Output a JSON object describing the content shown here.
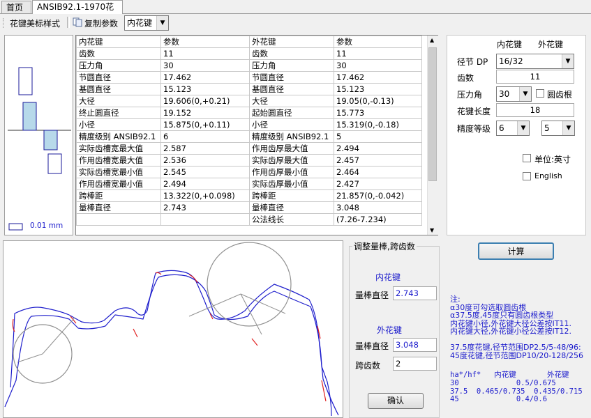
{
  "tabs": [
    "首页",
    "ANSIB92.1-1970花键"
  ],
  "toolbar": {
    "style_label": "花键美标样式",
    "copy_label": "复制参数",
    "select_value": "内花键"
  },
  "tolerance": {
    "scale_label": "0.01 mm"
  },
  "table": {
    "headers": [
      "内花键",
      "参数",
      "外花键",
      "参数"
    ],
    "rows": [
      [
        "齿数",
        "11",
        "齿数",
        "11"
      ],
      [
        "压力角",
        "30",
        "压力角",
        "30"
      ],
      [
        "节圆直径",
        "17.462",
        "节圆直径",
        "17.462"
      ],
      [
        "基圆直径",
        "15.123",
        "基圆直径",
        "15.123"
      ],
      [
        "大径",
        "19.606(0,+0.21)",
        "大径",
        "19.05(0,-0.13)"
      ],
      [
        "终止圆直径",
        "19.152",
        "起始圆直径",
        "15.773"
      ],
      [
        "小径",
        "15.875(0,+0.11)",
        "小径",
        "15.319(0,-0.18)"
      ],
      [
        "精度级别 ANSIB92.1",
        "6",
        "精度级别 ANSIB92.1",
        "5"
      ],
      [
        "实际齿槽宽最大值",
        "2.587",
        "作用齿厚最大值",
        "2.494"
      ],
      [
        "作用齿槽宽最大值",
        "2.536",
        "实际齿厚最大值",
        "2.457"
      ],
      [
        "实际齿槽宽最小值",
        "2.545",
        "作用齿厚最小值",
        "2.464"
      ],
      [
        "作用齿槽宽最小值",
        "2.494",
        "实际齿厚最小值",
        "2.427"
      ],
      [
        "跨棒距",
        "13.322(0,+0.098)",
        "跨棒距",
        "21.857(0,-0.042)"
      ],
      [
        "量棒直径",
        "2.743",
        "量棒直径",
        "3.048"
      ],
      [
        "",
        "",
        "公法线长",
        "(7.26-7.234)"
      ]
    ]
  },
  "params": {
    "col_internal": "内花键",
    "col_external": "外花键",
    "pitch_label": "径节 DP",
    "pitch_value": "16/32",
    "teeth_label": "齿数",
    "teeth_value": "11",
    "pressure_label": "压力角",
    "pressure_value": "30",
    "root_label": "圆齿根",
    "length_label": "花键长度",
    "length_value": "18",
    "grade_label": "精度等级",
    "grade_internal": "6",
    "grade_external": "5",
    "unit_label": "单位:英寸",
    "english_label": "English"
  },
  "adjust": {
    "title": "调整量棒,跨齿数",
    "internal_title": "内花键",
    "internal_pin_label": "量棒直径",
    "internal_pin_value": "2.743",
    "external_title": "外花键",
    "external_pin_label": "量棒直径",
    "external_pin_value": "3.048",
    "span_label": "跨齿数",
    "span_value": "2",
    "confirm_label": "确认"
  },
  "calc_label": "计算",
  "notes": {
    "lines": [
      "注:",
      "α30度可勾选取圆齿根",
      "α37.5度,45度只有圆齿根类型",
      "内花键小径,外花键大径公差按IT11.",
      "内花键大径,外花键小径公差按IT12.",
      "",
      "37.5度花键,径节范围DP2.5/5-48/96:",
      "45度花键,径节范围DP10/20-128/256"
    ],
    "table_header": "ha*/hf*   内花键       外花键",
    "table_rows": [
      "30             0.5/0.675",
      "37.5  0.465/0.735  0.435/0.715",
      "45             0.4/0.6"
    ]
  },
  "colors": {
    "profile_blue": "#1e1ecc",
    "profile_red": "#e02020",
    "tol_fill": "#b7d9ea",
    "tol_border": "#1a1a9a"
  }
}
